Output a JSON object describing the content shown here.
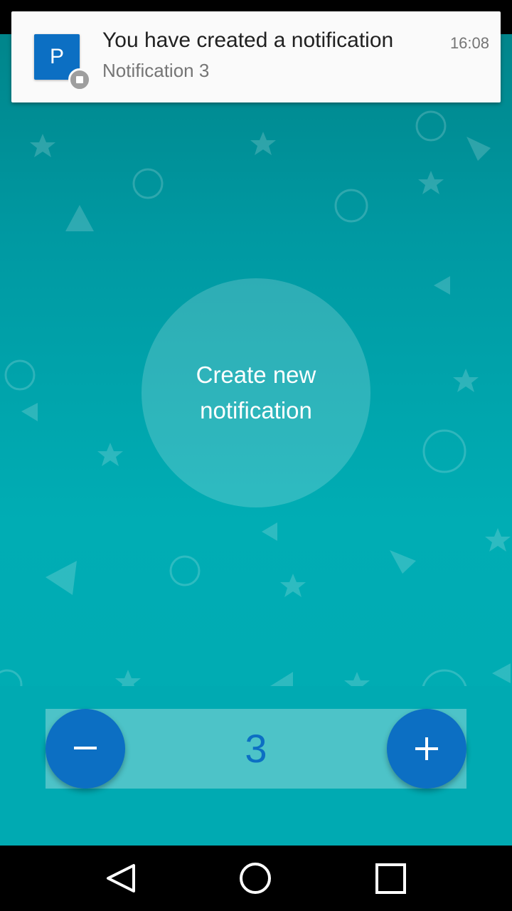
{
  "notification": {
    "app_icon_letter": "P",
    "title": "You have created a notification",
    "text": "Notification 3",
    "time": "16:08"
  },
  "main": {
    "create_button_label": "Create new notification"
  },
  "counter": {
    "value": "3"
  },
  "icons": {
    "decrement": "minus-icon",
    "increment": "plus-icon",
    "nav_back": "back-triangle-icon",
    "nav_home": "home-circle-icon",
    "nav_recents": "recents-square-icon"
  },
  "colors": {
    "accent": "#0c6fc3",
    "background_top": "#00858b",
    "background_bottom": "#00aab2",
    "counter_track": "#4dc3c8"
  }
}
